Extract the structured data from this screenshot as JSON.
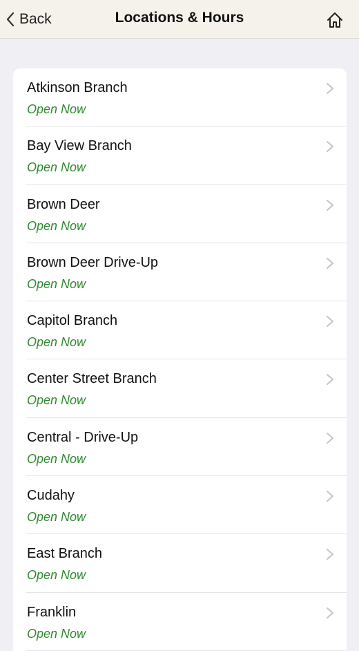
{
  "header": {
    "back_label": "Back",
    "title": "Locations & Hours",
    "back_icon": "chevron-left-icon",
    "home_icon": "home-icon"
  },
  "colors": {
    "status_open": "#2f8a2f",
    "nav_background": "#f4f2ea",
    "page_background": "#efeff4"
  },
  "locations": [
    {
      "name": "Atkinson Branch",
      "status": "Open Now"
    },
    {
      "name": "Bay View Branch",
      "status": "Open Now"
    },
    {
      "name": "Brown Deer",
      "status": "Open Now"
    },
    {
      "name": "Brown Deer Drive-Up",
      "status": "Open Now"
    },
    {
      "name": "Capitol Branch",
      "status": "Open Now"
    },
    {
      "name": "Center Street Branch",
      "status": "Open Now"
    },
    {
      "name": "Central - Drive-Up",
      "status": "Open Now"
    },
    {
      "name": "Cudahy",
      "status": "Open Now"
    },
    {
      "name": "East Branch",
      "status": "Open Now"
    },
    {
      "name": "Franklin",
      "status": "Open Now"
    }
  ]
}
